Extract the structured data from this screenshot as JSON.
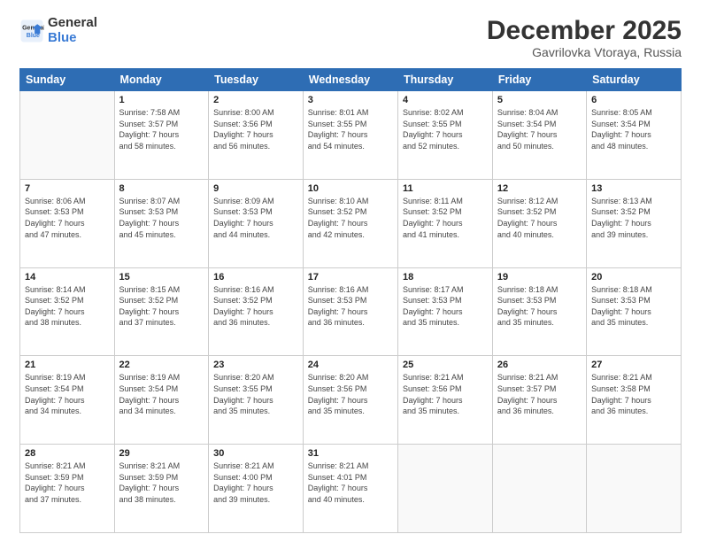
{
  "logo": {
    "line1": "General",
    "line2": "Blue"
  },
  "title": "December 2025",
  "location": "Gavrilovka Vtoraya, Russia",
  "weekdays": [
    "Sunday",
    "Monday",
    "Tuesday",
    "Wednesday",
    "Thursday",
    "Friday",
    "Saturday"
  ],
  "weeks": [
    [
      {
        "day": "",
        "info": ""
      },
      {
        "day": "1",
        "info": "Sunrise: 7:58 AM\nSunset: 3:57 PM\nDaylight: 7 hours\nand 58 minutes."
      },
      {
        "day": "2",
        "info": "Sunrise: 8:00 AM\nSunset: 3:56 PM\nDaylight: 7 hours\nand 56 minutes."
      },
      {
        "day": "3",
        "info": "Sunrise: 8:01 AM\nSunset: 3:55 PM\nDaylight: 7 hours\nand 54 minutes."
      },
      {
        "day": "4",
        "info": "Sunrise: 8:02 AM\nSunset: 3:55 PM\nDaylight: 7 hours\nand 52 minutes."
      },
      {
        "day": "5",
        "info": "Sunrise: 8:04 AM\nSunset: 3:54 PM\nDaylight: 7 hours\nand 50 minutes."
      },
      {
        "day": "6",
        "info": "Sunrise: 8:05 AM\nSunset: 3:54 PM\nDaylight: 7 hours\nand 48 minutes."
      }
    ],
    [
      {
        "day": "7",
        "info": "Sunrise: 8:06 AM\nSunset: 3:53 PM\nDaylight: 7 hours\nand 47 minutes."
      },
      {
        "day": "8",
        "info": "Sunrise: 8:07 AM\nSunset: 3:53 PM\nDaylight: 7 hours\nand 45 minutes."
      },
      {
        "day": "9",
        "info": "Sunrise: 8:09 AM\nSunset: 3:53 PM\nDaylight: 7 hours\nand 44 minutes."
      },
      {
        "day": "10",
        "info": "Sunrise: 8:10 AM\nSunset: 3:52 PM\nDaylight: 7 hours\nand 42 minutes."
      },
      {
        "day": "11",
        "info": "Sunrise: 8:11 AM\nSunset: 3:52 PM\nDaylight: 7 hours\nand 41 minutes."
      },
      {
        "day": "12",
        "info": "Sunrise: 8:12 AM\nSunset: 3:52 PM\nDaylight: 7 hours\nand 40 minutes."
      },
      {
        "day": "13",
        "info": "Sunrise: 8:13 AM\nSunset: 3:52 PM\nDaylight: 7 hours\nand 39 minutes."
      }
    ],
    [
      {
        "day": "14",
        "info": "Sunrise: 8:14 AM\nSunset: 3:52 PM\nDaylight: 7 hours\nand 38 minutes."
      },
      {
        "day": "15",
        "info": "Sunrise: 8:15 AM\nSunset: 3:52 PM\nDaylight: 7 hours\nand 37 minutes."
      },
      {
        "day": "16",
        "info": "Sunrise: 8:16 AM\nSunset: 3:52 PM\nDaylight: 7 hours\nand 36 minutes."
      },
      {
        "day": "17",
        "info": "Sunrise: 8:16 AM\nSunset: 3:53 PM\nDaylight: 7 hours\nand 36 minutes."
      },
      {
        "day": "18",
        "info": "Sunrise: 8:17 AM\nSunset: 3:53 PM\nDaylight: 7 hours\nand 35 minutes."
      },
      {
        "day": "19",
        "info": "Sunrise: 8:18 AM\nSunset: 3:53 PM\nDaylight: 7 hours\nand 35 minutes."
      },
      {
        "day": "20",
        "info": "Sunrise: 8:18 AM\nSunset: 3:53 PM\nDaylight: 7 hours\nand 35 minutes."
      }
    ],
    [
      {
        "day": "21",
        "info": "Sunrise: 8:19 AM\nSunset: 3:54 PM\nDaylight: 7 hours\nand 34 minutes."
      },
      {
        "day": "22",
        "info": "Sunrise: 8:19 AM\nSunset: 3:54 PM\nDaylight: 7 hours\nand 34 minutes."
      },
      {
        "day": "23",
        "info": "Sunrise: 8:20 AM\nSunset: 3:55 PM\nDaylight: 7 hours\nand 35 minutes."
      },
      {
        "day": "24",
        "info": "Sunrise: 8:20 AM\nSunset: 3:56 PM\nDaylight: 7 hours\nand 35 minutes."
      },
      {
        "day": "25",
        "info": "Sunrise: 8:21 AM\nSunset: 3:56 PM\nDaylight: 7 hours\nand 35 minutes."
      },
      {
        "day": "26",
        "info": "Sunrise: 8:21 AM\nSunset: 3:57 PM\nDaylight: 7 hours\nand 36 minutes."
      },
      {
        "day": "27",
        "info": "Sunrise: 8:21 AM\nSunset: 3:58 PM\nDaylight: 7 hours\nand 36 minutes."
      }
    ],
    [
      {
        "day": "28",
        "info": "Sunrise: 8:21 AM\nSunset: 3:59 PM\nDaylight: 7 hours\nand 37 minutes."
      },
      {
        "day": "29",
        "info": "Sunrise: 8:21 AM\nSunset: 3:59 PM\nDaylight: 7 hours\nand 38 minutes."
      },
      {
        "day": "30",
        "info": "Sunrise: 8:21 AM\nSunset: 4:00 PM\nDaylight: 7 hours\nand 39 minutes."
      },
      {
        "day": "31",
        "info": "Sunrise: 8:21 AM\nSunset: 4:01 PM\nDaylight: 7 hours\nand 40 minutes."
      },
      {
        "day": "",
        "info": ""
      },
      {
        "day": "",
        "info": ""
      },
      {
        "day": "",
        "info": ""
      }
    ]
  ]
}
